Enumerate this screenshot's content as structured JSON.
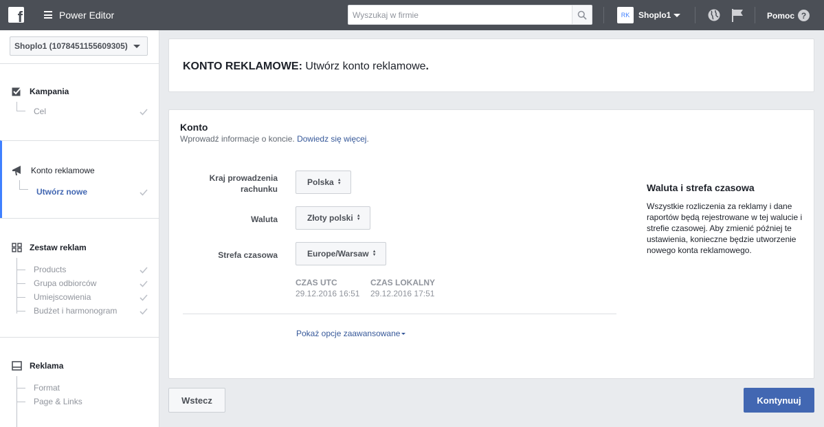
{
  "topbar": {
    "logo_letter": "f",
    "app_title": "Power Editor",
    "search_placeholder": "Wyszukaj w firmie",
    "account_badge": "RK",
    "account_name": "Shoplo1",
    "help_label": "Pomoc",
    "help_symbol": "?"
  },
  "sidebar": {
    "account_select": "Shoplo1 (1078451155609305)",
    "sections": {
      "kampania": {
        "title": "Kampania",
        "items": [
          "Cel"
        ]
      },
      "konto": {
        "title": "Konto reklamowe",
        "items": [
          "Utwórz nowe"
        ]
      },
      "zestaw": {
        "title": "Zestaw reklam",
        "items": [
          "Products",
          "Grupa odbiorców",
          "Umiejscowienia",
          "Budżet i harmonogram"
        ]
      },
      "reklama": {
        "title": "Reklama",
        "items": [
          "Format",
          "Page & Links"
        ]
      }
    }
  },
  "main": {
    "header_bold": "KONTO REKLAMOWE:",
    "header_text": " Utwórz konto reklamowe",
    "header_dot": ".",
    "konto_title": "Konto",
    "konto_sub": "Wprowadź informacje o koncie. ",
    "konto_link": "Dowiedz się więcej",
    "konto_link_end": ".",
    "fields": {
      "country_label_1": "Kraj prowadzenia",
      "country_label_2": "rachunku",
      "country_value": "Polska",
      "currency_label": "Waluta",
      "currency_value": "Złoty polski",
      "timezone_label": "Strefa czasowa",
      "timezone_value": "Europe/Warsaw",
      "utc_label": "CZAS UTC",
      "utc_value": "29.12.2016 16:51",
      "local_label": "CZAS LOKALNY",
      "local_value": "29.12.2016 17:51"
    },
    "advanced_link": "Pokaż opcje zaawansowane",
    "info_title": "Waluta i strefa czasowa",
    "info_text": "Wszystkie rozliczenia za reklamy i dane raportów będą rejestrowane w tej walucie i strefie czasowej. Aby zmienić później te ustawienia, konieczne będzie utworzenie nowego konta reklamowego."
  },
  "footer": {
    "back_label": "Wstecz",
    "next_label": "Kontynuuj"
  },
  "colors": {
    "topbar": "#4b4f56",
    "accent": "#4267b2",
    "active_border": "#4080ff",
    "link": "#365899"
  }
}
